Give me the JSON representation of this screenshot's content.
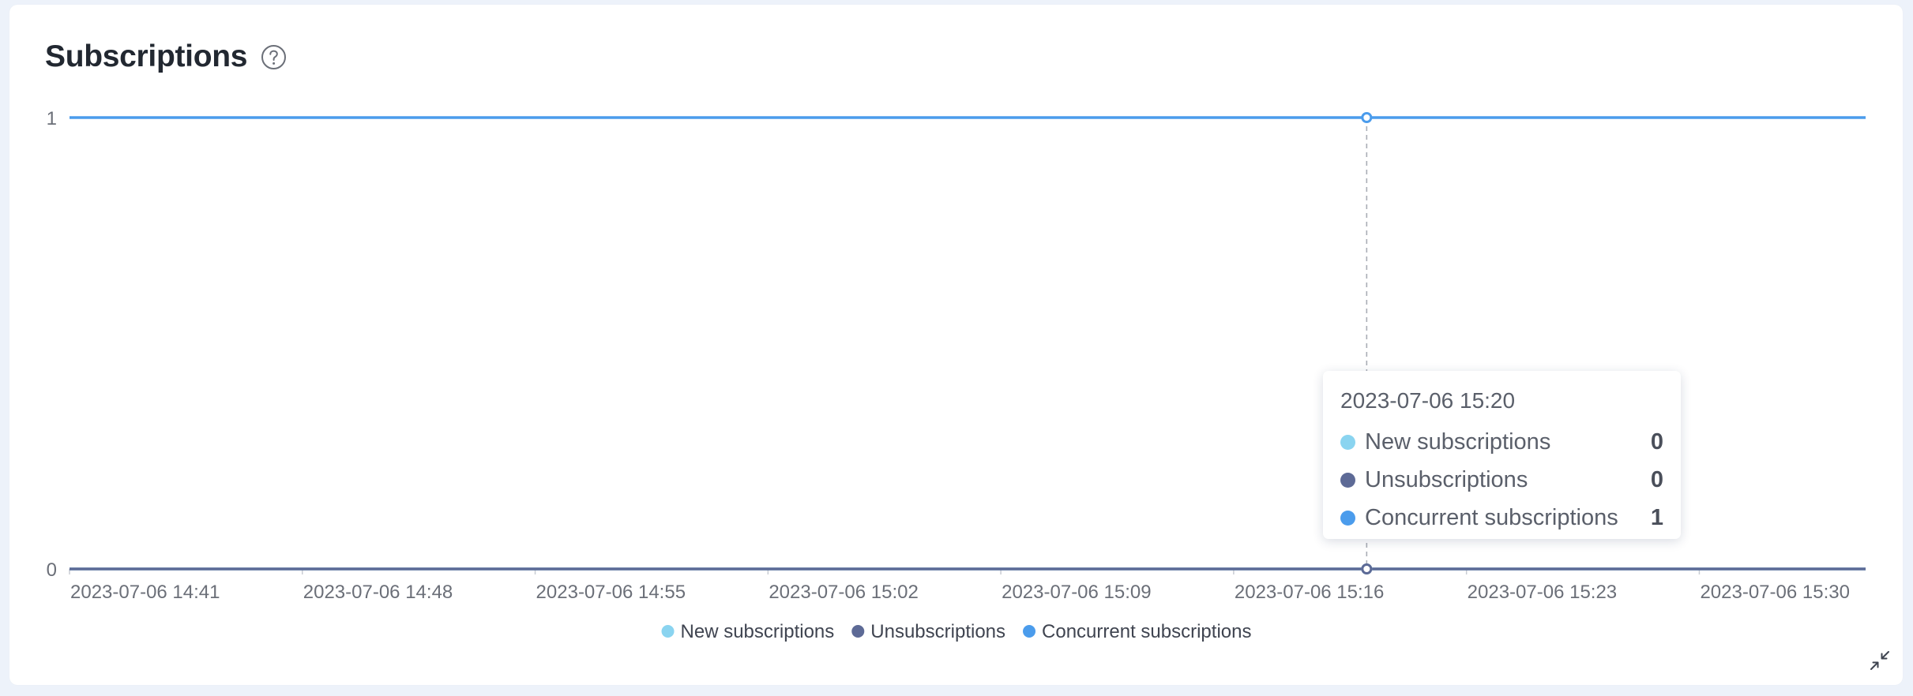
{
  "header": {
    "title": "Subscriptions"
  },
  "icons": {
    "help": "question-circle-icon",
    "collapse": "collapse-arrows-icon"
  },
  "colors": {
    "new_subscriptions": "#8ad4f0",
    "unsubscriptions": "#5d6a96",
    "concurrent_subscriptions": "#4b9cec"
  },
  "chart_data": {
    "type": "line",
    "title": "Subscriptions",
    "xlabel": "",
    "ylabel": "",
    "ylim": [
      0,
      1
    ],
    "y_ticks": [
      "0",
      "1"
    ],
    "x_tick_labels": [
      "2023-07-06 14:41",
      "2023-07-06 14:48",
      "2023-07-06 14:55",
      "2023-07-06 15:02",
      "2023-07-06 15:09",
      "2023-07-06 15:16",
      "2023-07-06 15:23",
      "2023-07-06 15:30"
    ],
    "x_start": "2023-07-06 14:41",
    "x_end": "2023-07-06 15:35",
    "series": [
      {
        "name": "New subscriptions",
        "values": [
          0,
          0
        ],
        "color": "#8ad4f0"
      },
      {
        "name": "Unsubscriptions",
        "values": [
          0,
          0
        ],
        "color": "#5d6a96"
      },
      {
        "name": "Concurrent subscriptions",
        "values": [
          1,
          1
        ],
        "color": "#4b9cec"
      }
    ],
    "grid": false,
    "legend_position": "bottom-center",
    "hover": {
      "x": "2023-07-06 15:20"
    }
  },
  "tooltip": {
    "title": "2023-07-06 15:20",
    "rows": [
      {
        "name": "New subscriptions",
        "value": "0"
      },
      {
        "name": "Unsubscriptions",
        "value": "0"
      },
      {
        "name": "Concurrent subscriptions",
        "value": "1"
      }
    ]
  }
}
